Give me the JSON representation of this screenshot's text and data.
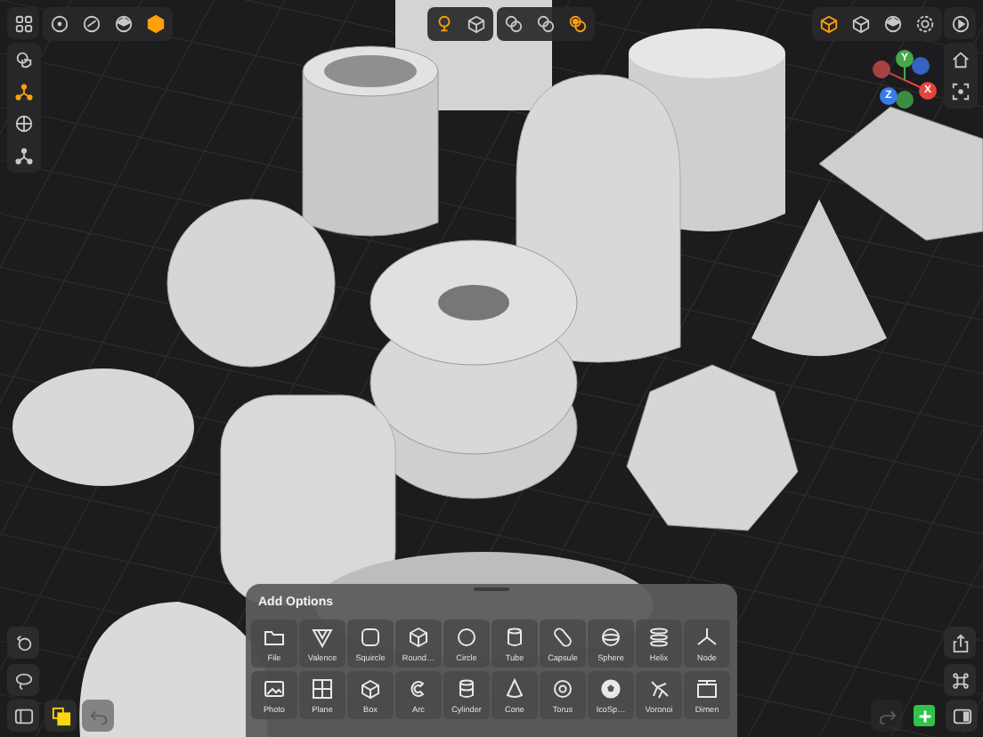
{
  "top_toolbar": {
    "tools": [
      {
        "selected": false
      },
      {
        "selected": false
      },
      {
        "selected": false
      },
      {
        "selected": true
      }
    ]
  },
  "left_toolbar": {
    "tools": [
      {
        "selected": false
      },
      {
        "selected": true
      },
      {
        "selected": false
      },
      {
        "selected": false
      }
    ]
  },
  "center_toolbar": {
    "groups": [
      [
        {
          "selected": true
        },
        {
          "selected": false
        }
      ],
      [
        {
          "selected": false
        },
        {
          "selected": false
        },
        {
          "selected": true
        }
      ]
    ]
  },
  "right_toolbar": {
    "tools": [
      {
        "selected": true
      },
      {
        "selected": false
      },
      {
        "selected": false
      },
      {
        "selected": false
      }
    ]
  },
  "axis_gizmo": {
    "axes": [
      {
        "label": "Y",
        "color": "#45a849"
      },
      {
        "label": "X",
        "color": "#e5453d"
      },
      {
        "label": "Z",
        "color": "#3a7bea"
      }
    ]
  },
  "bottom_left": [
    {
      "disabled": false
    },
    {
      "disabled": false
    },
    {
      "disabled": false
    },
    {
      "disabled": false
    },
    {
      "disabled": true
    }
  ],
  "bottom_right": [
    {
      "disabled": false
    },
    {
      "disabled": false
    },
    {
      "disabled": true
    },
    {
      "disabled": false
    },
    {
      "disabled": false
    }
  ],
  "add_options": {
    "title": "Add Options",
    "items": [
      {
        "label": "File"
      },
      {
        "label": "Valence"
      },
      {
        "label": "Squircle"
      },
      {
        "label": "Round…"
      },
      {
        "label": "Circle"
      },
      {
        "label": "Tube"
      },
      {
        "label": "Capsule"
      },
      {
        "label": "Sphere"
      },
      {
        "label": "Helix"
      },
      {
        "label": "Node"
      },
      {
        "label": "Photo"
      },
      {
        "label": "Plane"
      },
      {
        "label": "Box"
      },
      {
        "label": "Arc"
      },
      {
        "label": "Cylinder"
      },
      {
        "label": "Cone"
      },
      {
        "label": "Torus"
      },
      {
        "label": "IcoSp…"
      },
      {
        "label": "Voronoi"
      },
      {
        "label": "Dimen"
      }
    ]
  }
}
